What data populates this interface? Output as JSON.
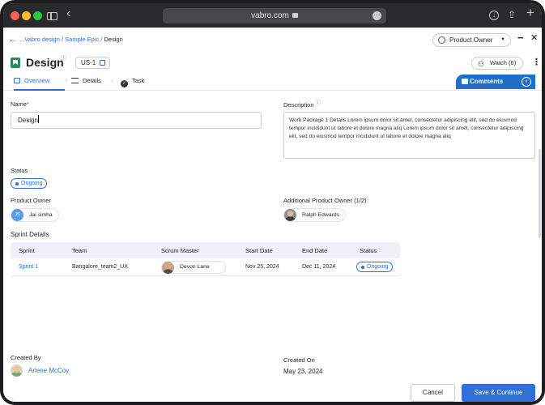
{
  "browser": {
    "url": "vabro.com",
    "icons": [
      "sidebar-icon",
      "back-chevron-icon",
      "lock-icon",
      "more-icon",
      "download-icon",
      "share-icon",
      "plus-icon"
    ]
  },
  "breadcrumb": {
    "path": "...Vabro design / Sample Epic / ",
    "current": "Design"
  },
  "role_select": {
    "value": "Product Owner"
  },
  "title": {
    "text": "Design",
    "id": "US-1"
  },
  "watch": {
    "label": "Watch (6)"
  },
  "tabs": [
    {
      "label": "Overview"
    },
    {
      "label": "Details"
    },
    {
      "label": "Task"
    }
  ],
  "comments": {
    "label": "Comments"
  },
  "name": {
    "label": "Name",
    "required": "*",
    "value": "Design"
  },
  "description": {
    "label": "Description",
    "text": "Work Package 1 Details Lorem ipsum dolor sit amet, consectetur adipiscing elit, sed do eiusmod tempor incididunt ut labore et dolore magna aliq Lorem ipsum dolor sit amet, consectetur adipiscing elit, sed do eiusmod tempor incididunt ut labore et dolore magna aliq"
  },
  "status": {
    "label": "Status",
    "value": "Ongoing"
  },
  "product_owner": {
    "label": "Product Owner",
    "initials": "JS",
    "name": "Jai simha"
  },
  "additional_owner": {
    "label": "Additional Product Owner (1/2)",
    "name": "Ralph Edwards"
  },
  "sprint_details": {
    "title": "Sprint Details",
    "columns": [
      "Sprint",
      "Team",
      "Scrum Master",
      "Start Date",
      "End Date",
      "Status"
    ],
    "rows": [
      {
        "sprint": "Sprint 1",
        "team": "Bangalore_team2_UX",
        "scrum_master": "Devon Lane",
        "start": "Nov 25, 2024",
        "end": "Dec 11, 2024",
        "status": "Ongoing"
      }
    ]
  },
  "created_by": {
    "label": "Created By",
    "name": "Arlene McCoy"
  },
  "created_on": {
    "label": "Created On",
    "date": "May 23, 2024"
  },
  "footer": {
    "cancel": "Cancel",
    "save": "Save & Continue"
  },
  "colors": {
    "accent": "#2f6fd6",
    "comments": "#1e6fc9",
    "bookmark": "#1e8e5a"
  }
}
